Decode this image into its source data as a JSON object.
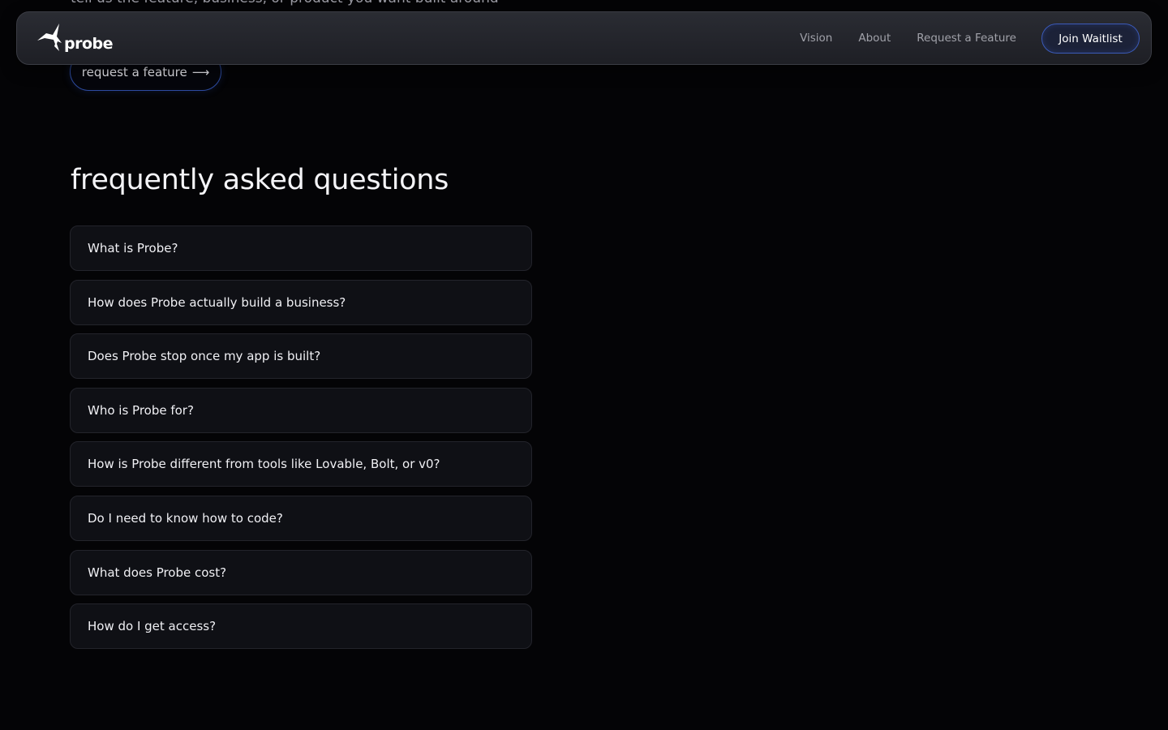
{
  "hero": {
    "cut_text": "tell us the feature, business, or product you want built around",
    "request_button_label": "request a feature",
    "request_button_icon": "arrow-right-icon",
    "request_button_arrow": "⟶"
  },
  "navbar": {
    "logo_text": "probe",
    "links": [
      "Vision",
      "About",
      "Request a Feature"
    ],
    "cta_label": "Join Waitlist"
  },
  "faq": {
    "title": "frequently asked questions",
    "items": [
      "What is Probe?",
      "How does Probe actually build a business?",
      "Does Probe stop once my app is built?",
      "Who is Probe for?",
      "How is Probe different from tools like Lovable, Bolt, or v0?",
      "Do I need to know how to code?",
      "What does Probe cost?",
      "How do I get access?"
    ]
  },
  "colors": {
    "background": "#040406",
    "navbar": "#24262c",
    "accent_border": "#3b5ab8",
    "faq_card": "#0f1015"
  }
}
